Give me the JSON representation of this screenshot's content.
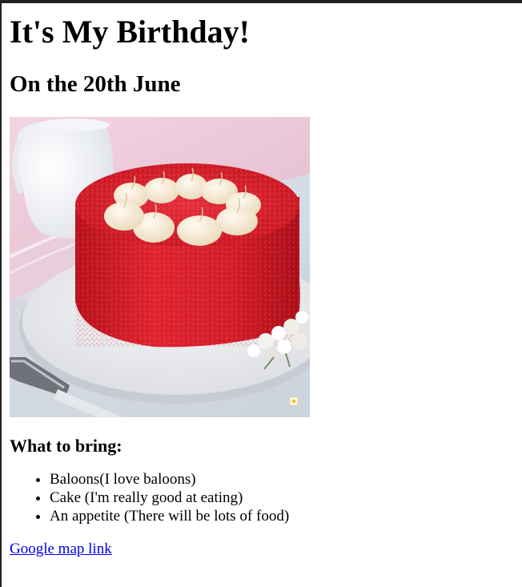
{
  "page": {
    "title": "It's My Birthday!",
    "date_heading": "On the 20th June",
    "image_alt": "red velvet cake with cream swirls",
    "bring_heading": "What to bring:",
    "bring_items": [
      "Baloons(I love baloons)",
      "Cake (I'm really good at eating)",
      "An appetite (There will be lots of food)"
    ],
    "map_link_label": "Google map link"
  },
  "colors": {
    "link": "#0000ee",
    "cake": "#d8202c"
  }
}
